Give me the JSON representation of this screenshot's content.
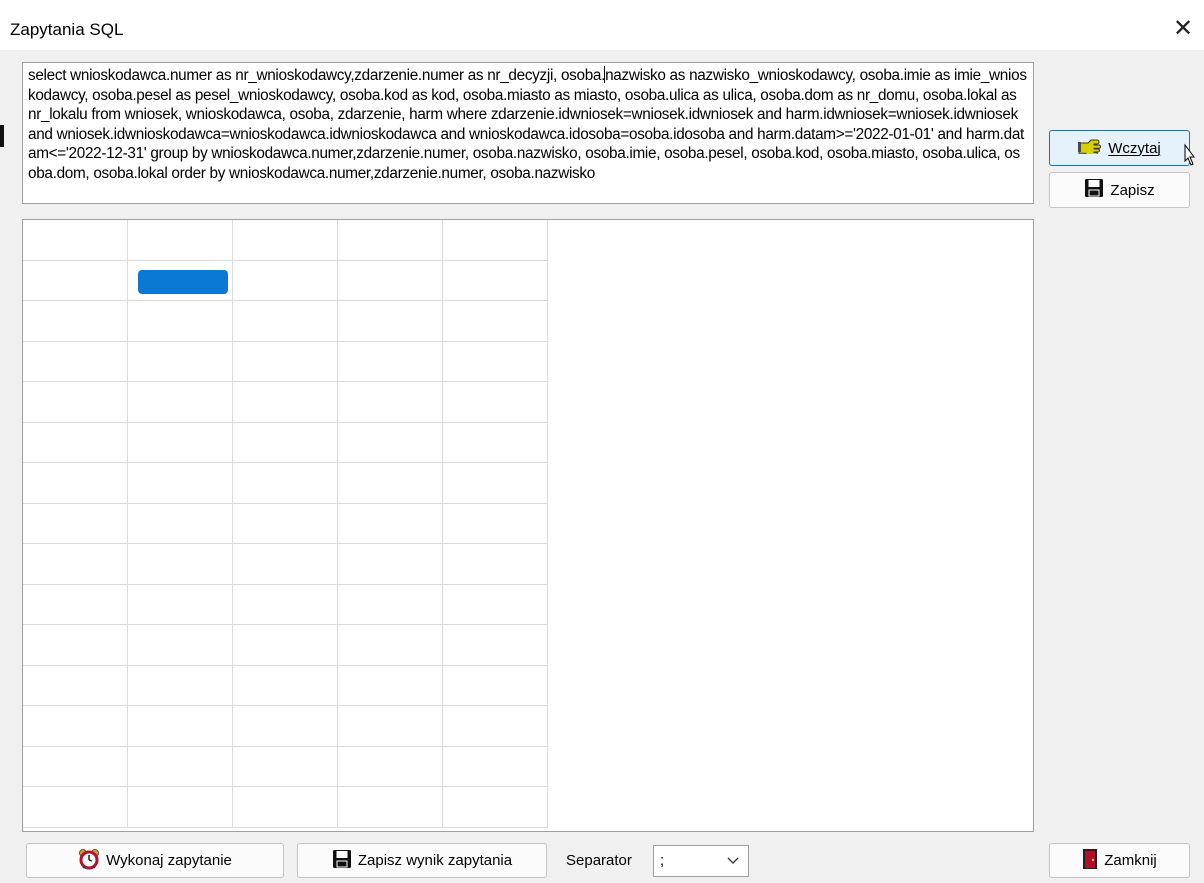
{
  "window": {
    "title": "Zapytania SQL",
    "close_glyph": "✕"
  },
  "sql": {
    "before_caret": "select wnioskodawca.numer as nr_wnioskodawcy,zdarzenie.numer as nr_decyzji, osoba.",
    "after_caret": "nazwisko as nazwisko_wnioskodawcy, osoba.imie as imie_wnioskodawcy, osoba.pesel as pesel_wnioskodawcy, osoba.kod as kod, osoba.miasto as miasto, osoba.ulica as ulica, osoba.dom as nr_domu, osoba.lokal as nr_lokalu from wniosek, wnioskodawca, osoba, zdarzenie, harm where zdarzenie.idwniosek=wniosek.idwniosek and harm.idwniosek=wniosek.idwniosek and wniosek.idwnioskodawca=wnioskodawca.idwnioskodawca and wnioskodawca.idosoba=osoba.idosoba and harm.datam>='2022-01-01' and harm.datam<='2022-12-31' group by wnioskodawca.numer,zdarzenie.numer, osoba.nazwisko, osoba.imie, osoba.pesel, osoba.kod, osoba.miasto, osoba.ulica, osoba.dom, osoba.lokal order by wnioskodawca.numer,zdarzenie.numer, osoba.nazwisko"
  },
  "buttons": {
    "load": {
      "label": "Wczytaj",
      "icon": "hand-pointing-icon"
    },
    "save": {
      "label": "Zapisz",
      "icon": "floppy-disk-icon"
    },
    "execute": {
      "label": "Wykonaj zapytanie",
      "icon": "alarm-clock-icon"
    },
    "save_result": {
      "label": "Zapisz wynik zapytania",
      "icon": "floppy-disk-icon"
    },
    "close": {
      "label": "Zamknij",
      "icon": "door-exit-icon"
    }
  },
  "separator": {
    "label": "Separator",
    "value": ";"
  },
  "colors": {
    "selection": "#0a79d4",
    "hover_border": "#0078d4",
    "hover_bg": "#e5f1fb"
  }
}
